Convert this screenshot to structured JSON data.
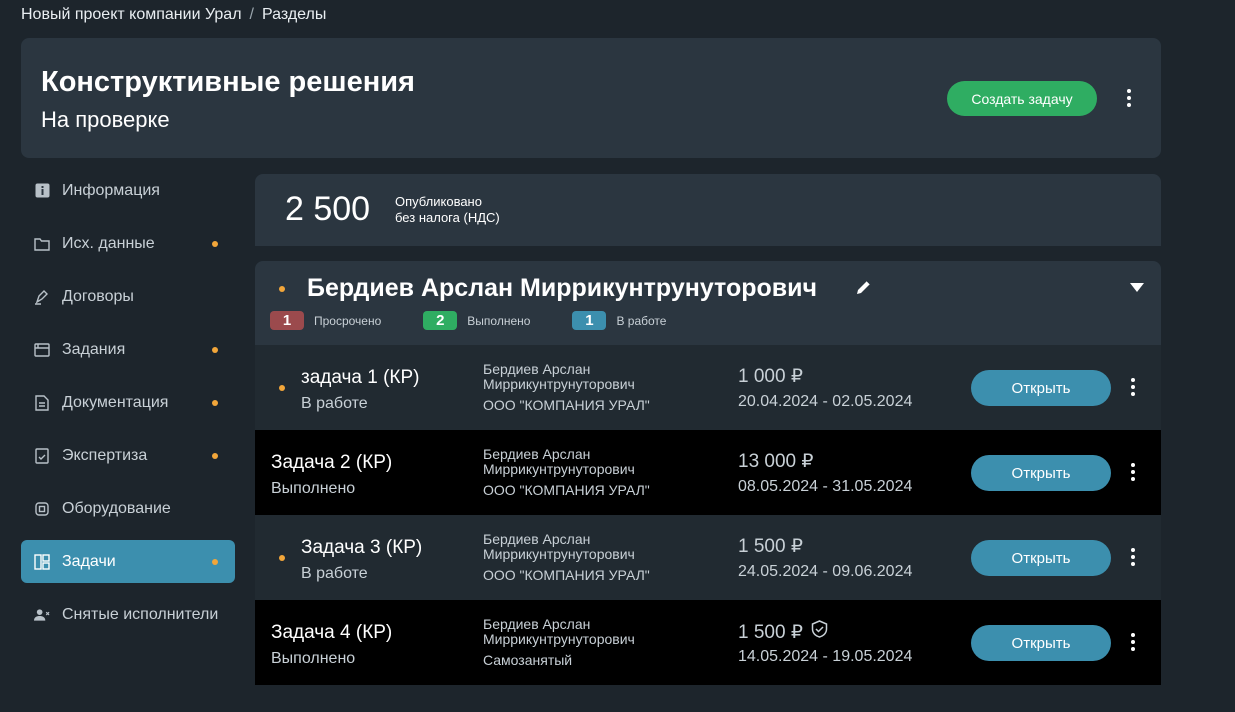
{
  "breadcrumb": {
    "project": "Новый проект компании Урал",
    "separator": "/",
    "section": "Разделы"
  },
  "header": {
    "title": "Конструктивные решения",
    "subtitle": "На проверке",
    "create_button": "Создать задачу"
  },
  "sidebar": {
    "items": [
      {
        "label": "Информация",
        "icon": "info-icon",
        "dot": false
      },
      {
        "label": "Исх. данные",
        "icon": "folder-icon",
        "dot": true
      },
      {
        "label": "Договоры",
        "icon": "pen-icon",
        "dot": false
      },
      {
        "label": "Задания",
        "icon": "cards-icon",
        "dot": true
      },
      {
        "label": "Документация",
        "icon": "document-icon",
        "dot": true
      },
      {
        "label": "Экспертиза",
        "icon": "check-document-icon",
        "dot": true
      },
      {
        "label": "Оборудование",
        "icon": "chip-icon",
        "dot": false
      },
      {
        "label": "Задачи",
        "icon": "layout-icon",
        "dot": true,
        "active": true
      },
      {
        "label": "Снятые исполнители",
        "icon": "remove-user-icon",
        "dot": false
      }
    ]
  },
  "summary": {
    "amount": "2 500",
    "label_line1": "Опубликовано",
    "label_line2": "без налога (НДС)"
  },
  "executor": {
    "name": "Бердиев Арслан Миррикунтрунуторович",
    "badges": [
      {
        "count": "1",
        "label": "Просрочено",
        "color": "#9b4a4d"
      },
      {
        "count": "2",
        "label": "Выполнено",
        "color": "#2fad62"
      },
      {
        "count": "1",
        "label": "В работе",
        "color": "#3c8fae"
      }
    ]
  },
  "tasks": [
    {
      "name": "задача 1 (КР)",
      "status": "В работе",
      "person_line1": "Бердиев Арслан",
      "person_line2": "Миррикунтрунуторович",
      "org": "ООО \"КОМПАНИЯ УРАЛ\"",
      "price": "1 000 ₽",
      "dates": "20.04.2024 - 02.05.2024",
      "open": "Открыть",
      "dot": true,
      "verified": false
    },
    {
      "name": "Задача 2 (КР)",
      "status": "Выполнено",
      "person_line1": "Бердиев Арслан",
      "person_line2": "Миррикунтрунуторович",
      "org": "ООО \"КОМПАНИЯ УРАЛ\"",
      "price": "13 000 ₽",
      "dates": "08.05.2024 - 31.05.2024",
      "open": "Открыть",
      "dot": false,
      "verified": false
    },
    {
      "name": "Задача 3 (КР)",
      "status": "В работе",
      "person_line1": "Бердиев Арслан",
      "person_line2": "Миррикунтрунуторович",
      "org": "ООО \"КОМПАНИЯ УРАЛ\"",
      "price": "1 500 ₽",
      "dates": "24.05.2024 - 09.06.2024",
      "open": "Открыть",
      "dot": true,
      "verified": false
    },
    {
      "name": "Задача 4 (КР)",
      "status": "Выполнено",
      "person_line1": "Бердиев Арслан",
      "person_line2": "Миррикунтрунуторович",
      "org": "Самозанятый",
      "price": "1 500 ₽",
      "dates": "14.05.2024 - 19.05.2024",
      "open": "Открыть",
      "dot": false,
      "verified": true
    }
  ]
}
